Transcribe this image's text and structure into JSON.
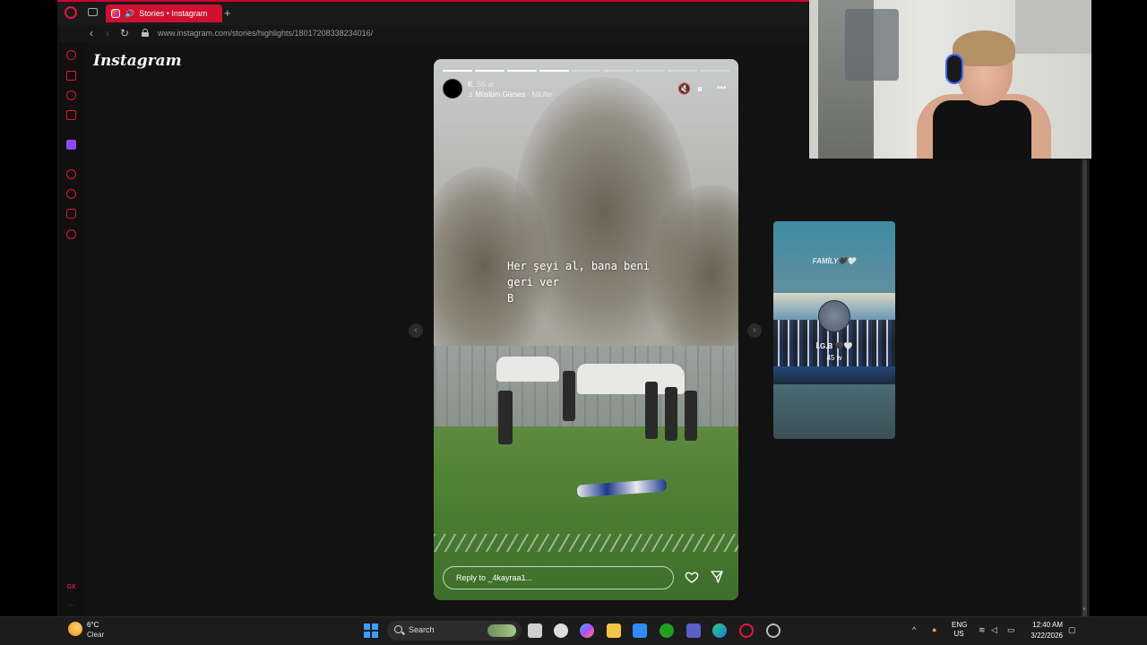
{
  "browser": {
    "tab_title": "Stories • Instagram",
    "new_tab_glyph": "+",
    "url": "www.instagram.com/stories/highlights/18017208338234016/",
    "back_glyph": "‹",
    "forward_glyph": "›",
    "reload_glyph": "↻"
  },
  "sidebar": {
    "icons": [
      "aria-icon",
      "bag-icon",
      "messenger-icon",
      "gmail-icon",
      "twitch-icon",
      "player-icon",
      "history-icon",
      "pinboard-icon",
      "settings-icon"
    ],
    "bottom_label": "GX",
    "more_glyph": "···"
  },
  "page": {
    "logo": "Instagram"
  },
  "story": {
    "username": "K",
    "age": "56 w",
    "music": "Müslüm Gürses",
    "location_sep": " · ",
    "location": "Nilüfer",
    "caption": "Her şeyi al, bana beni\ngeri ver\nB",
    "reply_placeholder": "Reply to _4kayraa1...",
    "progress_total": 9,
    "progress_done": 4,
    "mute_glyph": "🔇",
    "pause_glyph": "⏸",
    "more_glyph": "•••",
    "heart_icon": "heart-icon",
    "send_icon": "send-icon"
  },
  "next_story": {
    "header": "FAMİLY🖤🤍",
    "name": "İ.G.B 🖤🤍",
    "age": "45 w"
  },
  "arrows": {
    "prev": "‹",
    "next": "›"
  },
  "taskbar": {
    "temp": "6°C",
    "condition": "Clear",
    "search_label": "Search",
    "lang_top": "ENG",
    "lang_bottom": "US",
    "time": "12:40 AM",
    "date": "3/22/2026",
    "chevron_glyph": "^"
  },
  "colors": {
    "accent": "#d2002a",
    "page_bg": "#121212"
  }
}
